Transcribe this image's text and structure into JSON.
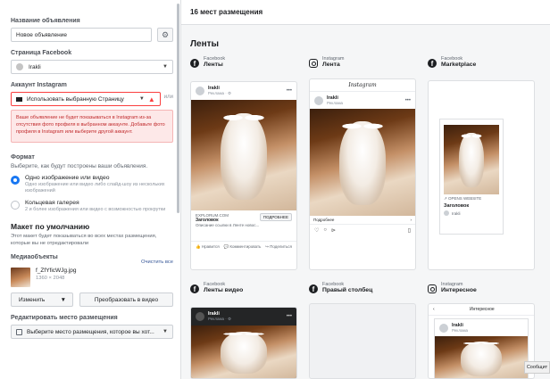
{
  "left": {
    "ad_name_label": "Название объявления",
    "ad_name_value": "Новое объявление",
    "fb_page_label": "Страница Facebook",
    "fb_page_value": "Irakli",
    "ig_account_label": "Аккаунт Instagram",
    "ig_account_value": "Использовать выбранную Страницу",
    "or_text": "или",
    "ig_error": "Ваше объявление не будет показываться в Instagram из-за отсутствия фото профиля в выбранном аккаунте. Добавьте фото профиля в Instagram или выберите другой аккаунт.",
    "format_label": "Формат",
    "format_sub": "Выберите, как будут построены ваши объявления.",
    "format_options": [
      {
        "title": "Одно изображение или видео",
        "desc": "Одно изображение или видео либо слайд-шоу из нескольких изображений"
      },
      {
        "title": "Кольцевая галерея",
        "desc": "2 и более изображения или видео с возможностью прокрутки"
      }
    ],
    "default_title": "Макет по умолчанию",
    "default_desc": "Этот макет будет показываться во всех местах размещения, которые вы не отредактировали",
    "media_label": "Медиаобъекты",
    "clear_all": "Очистить все",
    "file_name": "f_ZfYficWJg.jpg",
    "file_size": "1360 × 2048",
    "change_btn": "Изменить",
    "convert_btn": "Преобразовать в видео",
    "edit_place_label": "Редактировать место размещения",
    "edit_place_value": "Выберите место размещения, которое вы хот..."
  },
  "right": {
    "topbar_title": "16 мест размещения",
    "section_title": "Ленты",
    "placements": [
      {
        "platform": "Facebook",
        "name": "Ленты",
        "icon": "facebook-icon"
      },
      {
        "platform": "Instagram",
        "name": "Лента",
        "icon": "instagram-icon"
      },
      {
        "platform": "Facebook",
        "name": "Marketplace",
        "icon": "facebook-icon"
      },
      {
        "platform": "Facebook",
        "name": "Ленты видео",
        "icon": "facebook-icon"
      },
      {
        "platform": "Facebook",
        "name": "Правый столбец",
        "icon": "facebook-icon"
      },
      {
        "platform": "Instagram",
        "name": "Интересное",
        "icon": "instagram-icon"
      }
    ],
    "fb_preview": {
      "page_name": "Irakli",
      "sponsored": "Реклама · ⚙",
      "domain": "EXPLORUM.COM",
      "headline": "Заголовок",
      "desc": "Описание ссылки в Ленте новос...",
      "cta": "ПОДРОБНЕЕ",
      "like": "Нравится",
      "comment": "Комментировать",
      "share": "Поделиться"
    },
    "ig_preview": {
      "logo": "Instagram",
      "page_name": "Irakli",
      "sponsored": "Реклама",
      "more": "Подробнее"
    },
    "mp_preview": {
      "opens": "OPENS WEBSITE",
      "headline": "Заголовок",
      "page_name": "Irakli"
    },
    "video_preview": {
      "page_name": "Irakli",
      "sponsored": "Реклама · ⚙"
    },
    "explore_preview": {
      "header": "Интересное",
      "page_name": "Irakli",
      "sponsored": "Реклама"
    },
    "tooltip": "Сообщит"
  }
}
